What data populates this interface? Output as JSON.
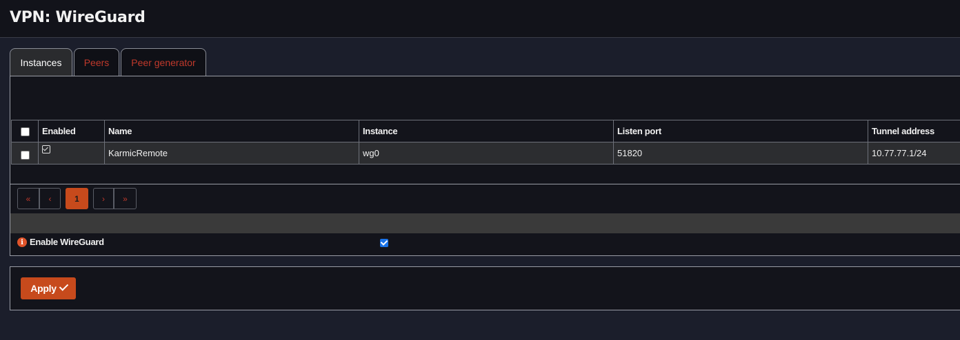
{
  "header": {
    "title": "VPN: WireGuard"
  },
  "tabs": [
    {
      "label": "Instances",
      "active": true
    },
    {
      "label": "Peers",
      "active": false
    },
    {
      "label": "Peer generator",
      "active": false
    }
  ],
  "table": {
    "columns": [
      "Enabled",
      "Name",
      "Instance",
      "Listen port",
      "Tunnel address"
    ],
    "rows": [
      {
        "enabled": true,
        "name": "KarmicRemote",
        "instance": "wg0",
        "listen_port": "51820",
        "tunnel_address": "10.77.77.1/24"
      }
    ]
  },
  "pager": {
    "first": "«",
    "prev": "‹",
    "current": "1",
    "next": "›",
    "last": "»"
  },
  "settings": {
    "enable_wireguard_label": "Enable WireGuard",
    "enable_wireguard_checked": true,
    "info_glyph": "i"
  },
  "actions": {
    "apply_label": "Apply"
  },
  "colors": {
    "accent": "#c74a1c",
    "link": "#c0392b",
    "background": "#1b1e2b"
  }
}
